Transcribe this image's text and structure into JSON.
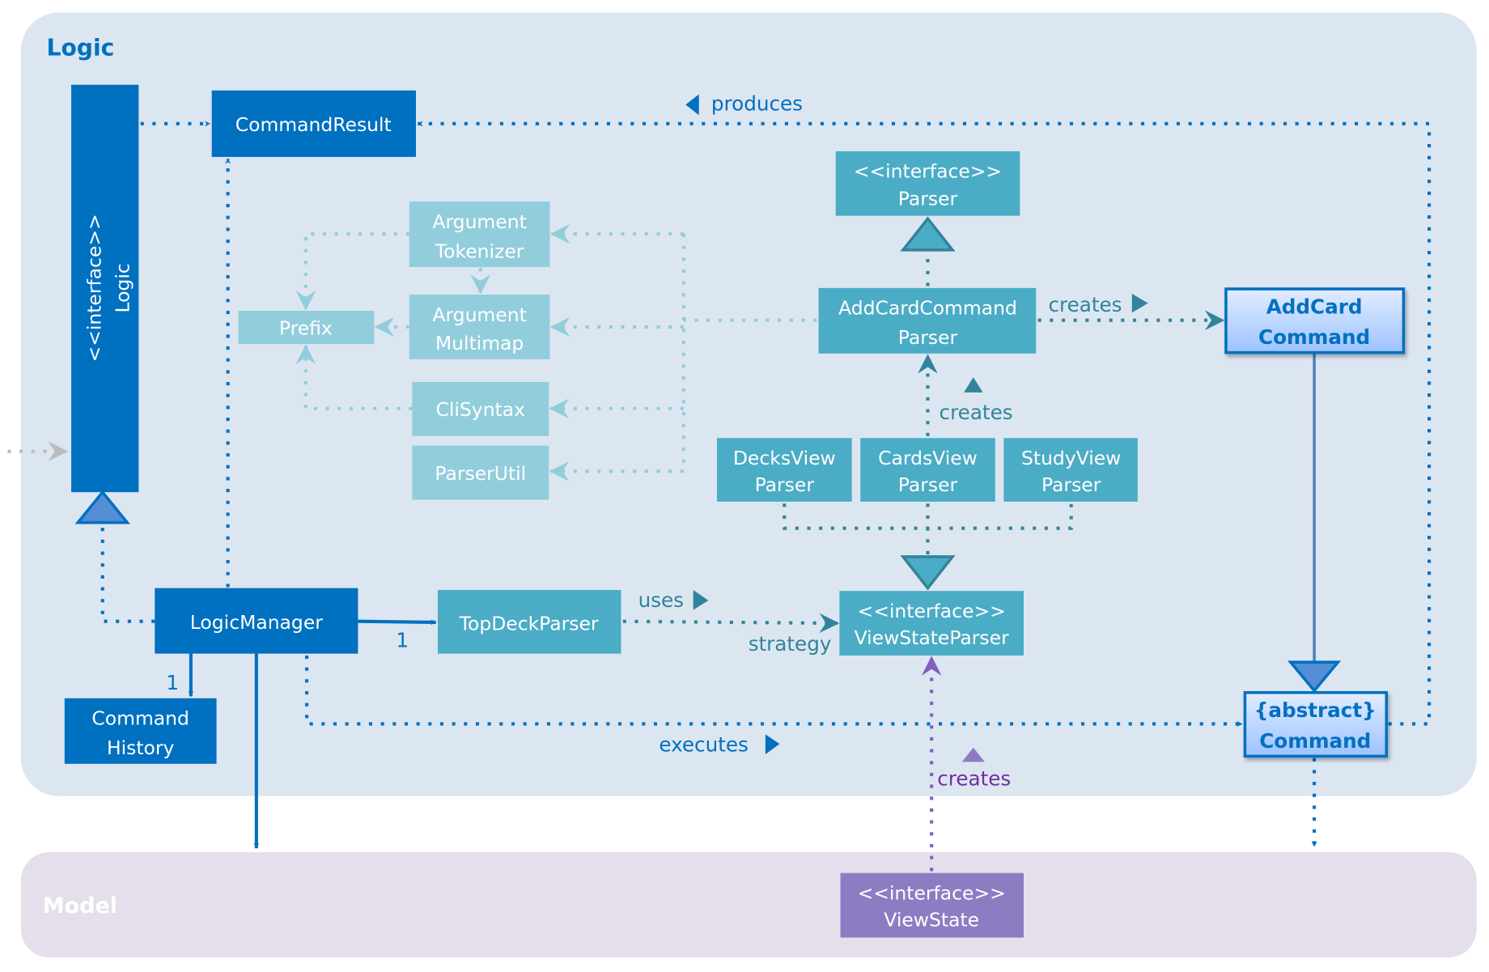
{
  "packages": {
    "logic": "Logic",
    "model": "Model"
  },
  "colors": {
    "logic_bg": "#dce6f1",
    "model_bg": "#e4dfeb",
    "dark_blue": "#0070c0",
    "teal": "#4bacc6",
    "light_teal": "#92cddc",
    "purple": "#8e7cc3"
  },
  "classes": {
    "logic_interface": [
      "<<interface>>",
      "Logic"
    ],
    "command_result": "CommandResult",
    "logic_manager": "LogicManager",
    "command_history": [
      "Command",
      "History"
    ],
    "top_deck_parser": "TopDeckParser",
    "argument_tokenizer": [
      "Argument",
      "Tokenizer"
    ],
    "argument_multimap": [
      "Argument",
      "Multimap"
    ],
    "prefix": "Prefix",
    "cli_syntax": "CliSyntax",
    "parser_util": "ParserUtil",
    "parser_interface": [
      "<<interface>>",
      "Parser"
    ],
    "add_card_command_parser": [
      "AddCardCommand",
      "Parser"
    ],
    "add_card_command": [
      "AddCard",
      "Command"
    ],
    "decks_view_parser": [
      "DecksView",
      "Parser"
    ],
    "cards_view_parser": [
      "CardsView",
      "Parser"
    ],
    "study_view_parser": [
      "StudyView",
      "Parser"
    ],
    "view_state_parser": [
      "<<interface>>",
      "ViewStateParser"
    ],
    "abstract_command": [
      "{abstract}",
      "Command"
    ],
    "view_state": [
      "<<interface>>",
      "ViewState"
    ]
  },
  "labels": {
    "produces": "produces",
    "creates_command": "creates",
    "creates_parser": "creates",
    "uses": "uses",
    "strategy": "strategy",
    "multiplicity_parser": "1",
    "multiplicity_history": "1",
    "executes": "executes",
    "creates_view_state": "creates"
  }
}
